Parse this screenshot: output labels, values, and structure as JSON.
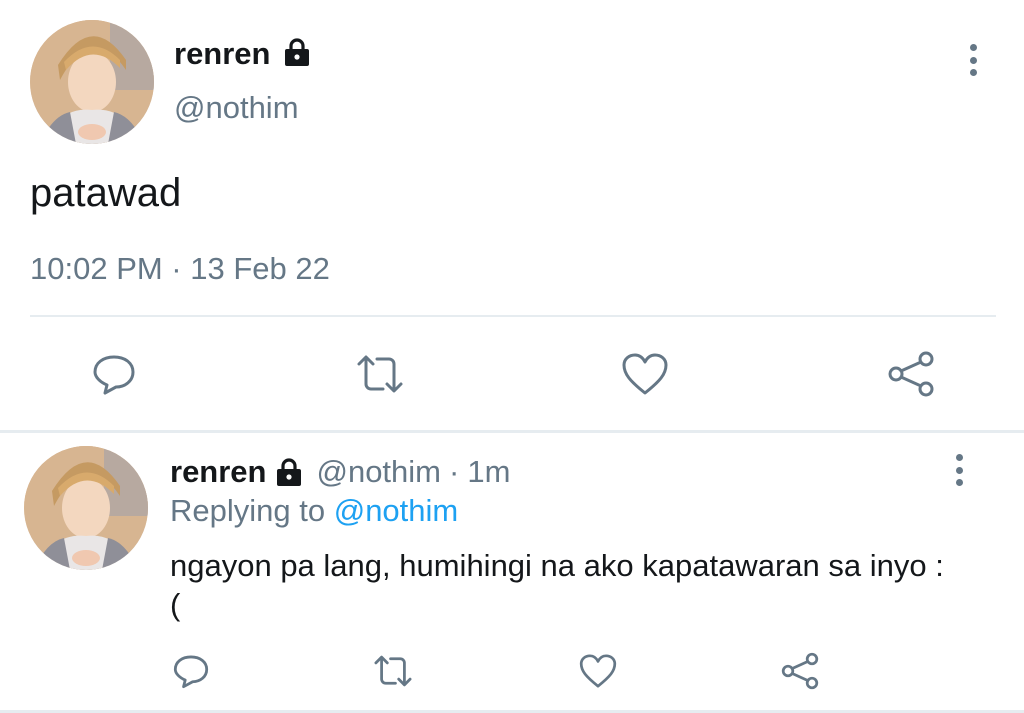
{
  "main_tweet": {
    "display_name": "renren",
    "handle": "@nothim",
    "text": "patawad",
    "timestamp": "10:02 PM · 13 Feb 22",
    "icons": [
      "lock-icon",
      "more-icon",
      "reply-icon",
      "retweet-icon",
      "like-icon",
      "share-icon"
    ]
  },
  "reply_tweet": {
    "display_name": "renren",
    "handle": "@nothim",
    "separator": "·",
    "time_ago": "1m",
    "replying_to_label": "Replying to",
    "replying_to_handle": "@nothim",
    "text": "ngayon pa lang, humihingi na ako kapatawaran sa inyo :(",
    "icons": [
      "lock-icon",
      "more-icon",
      "reply-icon",
      "retweet-icon",
      "like-icon",
      "share-icon"
    ]
  },
  "colors": {
    "text": "#14171a",
    "secondary": "#657786",
    "link": "#1da1f2",
    "divider": "#e6ecf0"
  }
}
